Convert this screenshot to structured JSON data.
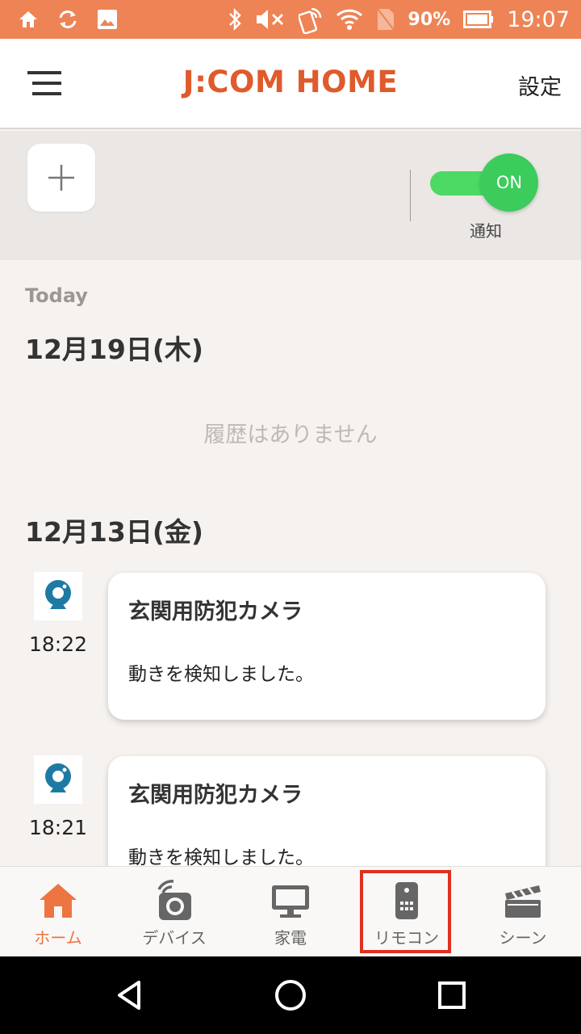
{
  "status_bar": {
    "battery": "90%",
    "time": "19:07",
    "icons": [
      "home-icon",
      "sync-icon",
      "image-icon",
      "bluetooth-icon",
      "mute-icon",
      "nfc-icon",
      "wifi-icon",
      "no-sim-icon",
      "battery-icon"
    ]
  },
  "header": {
    "brand": "J:COM HOME",
    "settings_label": "設定",
    "menu_icon": "hamburger-menu-icon"
  },
  "toolbar": {
    "add_icon": "plus-icon",
    "toggle_state": "ON",
    "toggle_label": "通知",
    "accent_color": "#4cd964"
  },
  "history": {
    "today_label": "Today",
    "groups": [
      {
        "date": "12月19日(木)",
        "empty_message": "履歴はありません",
        "entries": []
      },
      {
        "date": "12月13日(金)",
        "entries": [
          {
            "time": "18:22",
            "title": "玄関用防犯カメラ",
            "message": "動きを検知しました。",
            "icon": "security-camera-icon"
          },
          {
            "time": "18:21",
            "title": "玄関用防犯カメラ",
            "message": "動きを検知しました。",
            "icon": "security-camera-icon"
          }
        ]
      }
    ]
  },
  "bottom_nav": {
    "items": [
      {
        "label": "ホーム",
        "icon": "home-icon",
        "active": true
      },
      {
        "label": "デバイス",
        "icon": "device-icon",
        "active": false
      },
      {
        "label": "家電",
        "icon": "tv-icon",
        "active": false
      },
      {
        "label": "リモコン",
        "icon": "remote-icon",
        "active": false
      },
      {
        "label": "シーン",
        "icon": "clapperboard-icon",
        "active": false
      }
    ],
    "active_color": "#ee7442",
    "highlight_color": "#e0301e"
  },
  "system_nav": {
    "icons": [
      "back-icon",
      "home-circle-icon",
      "recents-icon"
    ]
  },
  "colors": {
    "status_bar": "#ee8455",
    "brand": "#e05a2b",
    "background": "#f6f2ef"
  }
}
